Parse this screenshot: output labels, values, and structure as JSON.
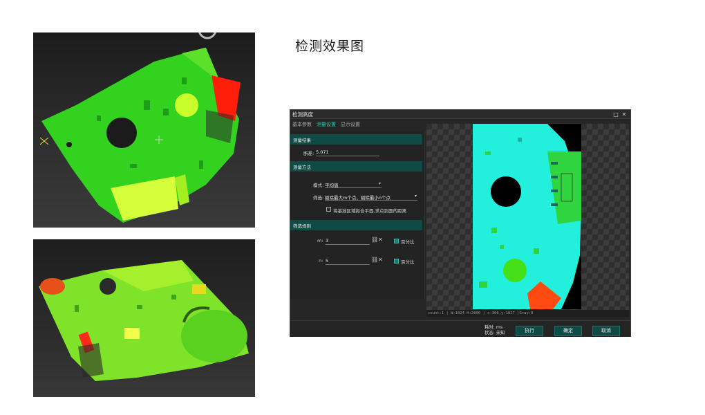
{
  "heading": "检测效果图",
  "window": {
    "title": "检测高度",
    "controls": {
      "maximize": "□",
      "close": "✕"
    },
    "tabs": [
      {
        "label": "基本参数",
        "active": false
      },
      {
        "label": "测量设置",
        "active": true
      },
      {
        "label": "显示设置",
        "active": false
      }
    ],
    "sections": {
      "result": "测量结果",
      "method": "测量方法",
      "filter": "筛选规则"
    },
    "result": {
      "label": "断差:",
      "value": "5.071"
    },
    "method": {
      "mode_label": "模式:",
      "mode_value": "平均值",
      "filter_label": "筛选:",
      "filter_value": "剔除最大m个点、剔除最小n个点",
      "checkbox_label": "将基准区域拟合平面,求点到面的距离"
    },
    "rules": [
      {
        "name": "m:",
        "value": "3",
        "percent_label": "百分比"
      },
      {
        "name": "n:",
        "value": "5",
        "percent_label": "百分比"
      }
    ],
    "viewer_status": "count:1 | W:1024 H:2000 | x:306,y:1827 |Gray:0",
    "footer": {
      "time_label": "耗时: ms",
      "state_label": "状态: 未知",
      "execute": "执行",
      "confirm": "确定",
      "cancel": "取消"
    }
  },
  "colors": {
    "accent": "#34c7b0",
    "section_bg": "#0f4a45",
    "button_bg": "#0f4a45"
  },
  "icons": [
    "link-icon",
    "clear-icon",
    "dropdown-caret-icon",
    "maximize-icon",
    "close-icon"
  ]
}
